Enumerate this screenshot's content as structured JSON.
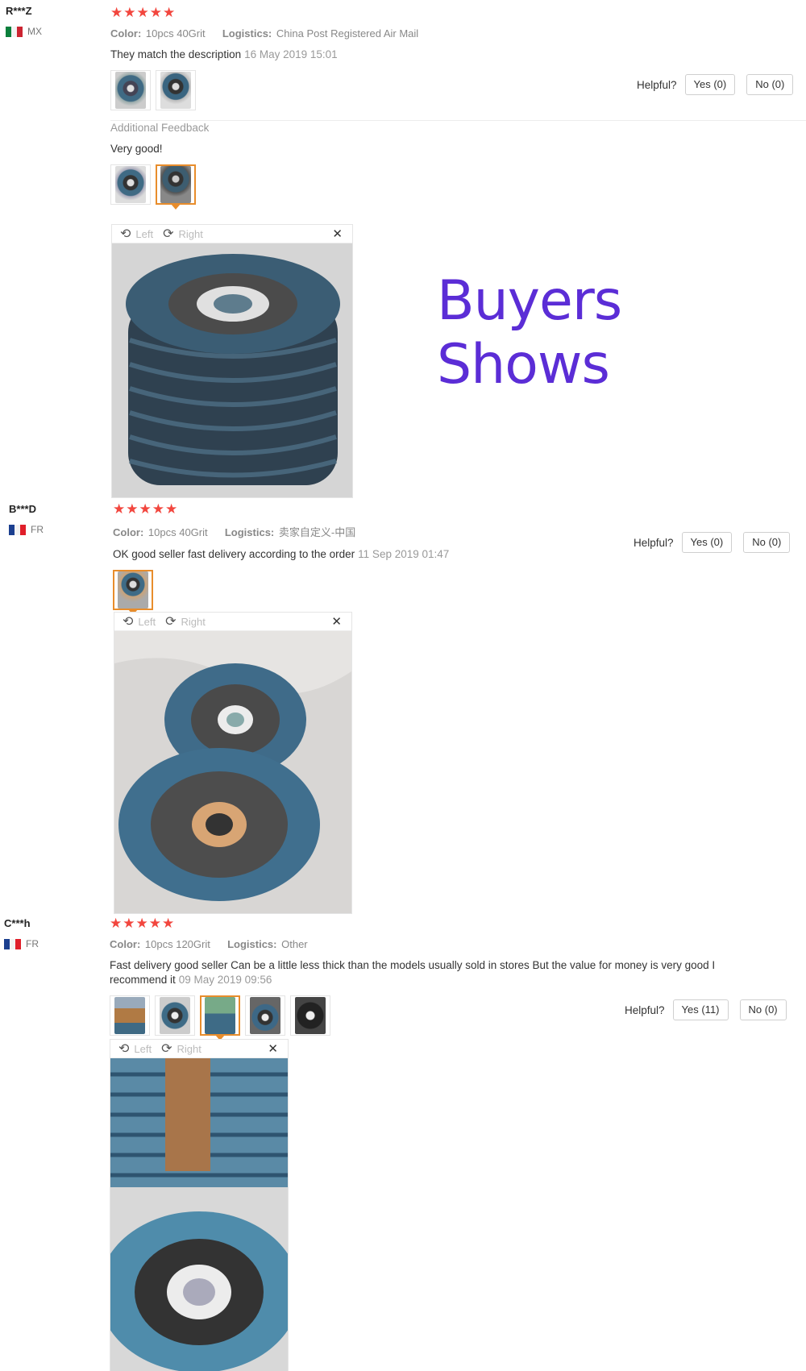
{
  "title": "Buyers Shows",
  "helpful_label": "Helpful?",
  "viewer": {
    "left_label": "Left",
    "right_label": "Right",
    "close": "✕"
  },
  "reviews": [
    {
      "user": "R***Z",
      "country": "MX",
      "stars": "★★★★★",
      "color_label": "Color:",
      "color": "10pcs 40Grit",
      "logistics_label": "Logistics:",
      "logistics": "China Post Registered Air Mail",
      "text": "They match the description",
      "date": "16 May 2019 15:01",
      "yes": "Yes (0)",
      "no": "No (0)",
      "additional_label": "Additional Feedback",
      "additional_text": "Very good!"
    },
    {
      "user": "B***D",
      "country": "FR",
      "stars": "★★★★★",
      "color_label": "Color:",
      "color": "10pcs 40Grit",
      "logistics_label": "Logistics:",
      "logistics": "卖家自定义-中国",
      "text": "OK good seller fast delivery according to the order",
      "date": "11 Sep 2019 01:47",
      "yes": "Yes (0)",
      "no": "No (0)"
    },
    {
      "user": "C***h",
      "country": "FR",
      "stars": "★★★★★",
      "color_label": "Color:",
      "color": "10pcs 120Grit",
      "logistics_label": "Logistics:",
      "logistics": "Other",
      "text": "Fast delivery good seller Can be a little less thick than the models usually sold in stores But the value for money is very good I recommend it",
      "date": "09 May 2019 09:56",
      "yes": "Yes (11)",
      "no": "No (0)"
    }
  ],
  "colors": {
    "star": "#f2463e",
    "accent": "#e88d2c",
    "title": "#5b2dd6",
    "disc": "#4a7f9d"
  }
}
